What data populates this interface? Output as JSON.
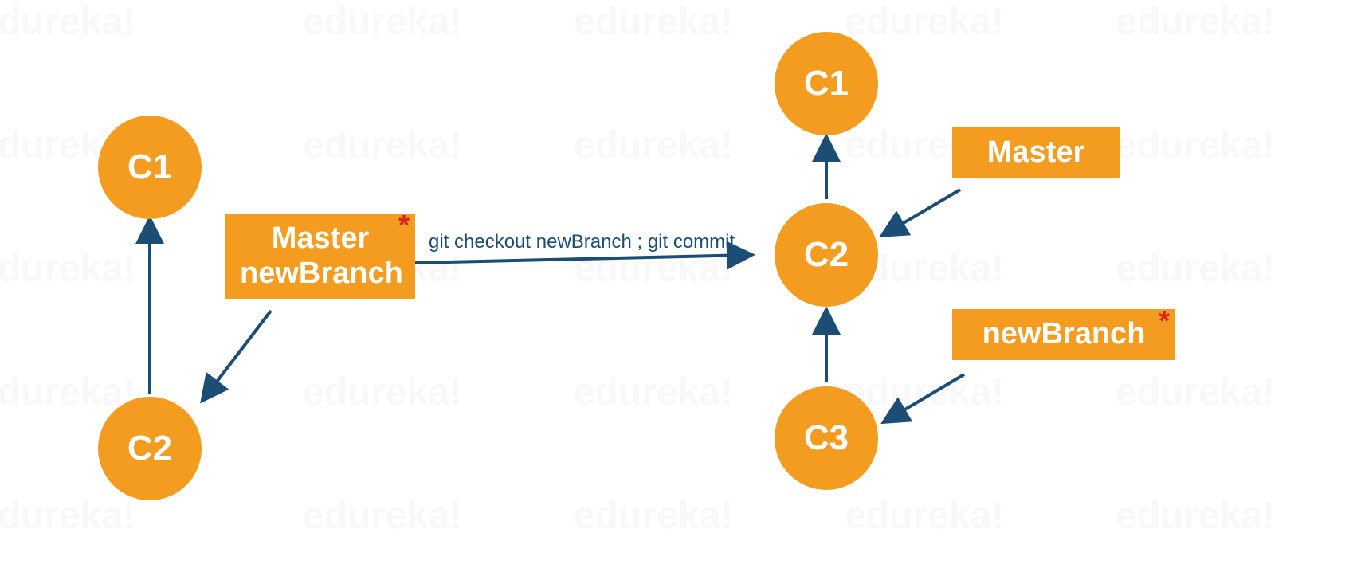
{
  "watermark": "edureka!",
  "left": {
    "commits": {
      "c1": "C1",
      "c2": "C2"
    },
    "branchBox": {
      "line1": "Master",
      "line2": "newBranch"
    }
  },
  "command": "git checkout newBranch ; git commit",
  "right": {
    "commits": {
      "c1": "C1",
      "c2": "C2",
      "c3": "C3"
    },
    "masterBox": "Master",
    "newBranchBox": "newBranch"
  },
  "asterisk": "*"
}
